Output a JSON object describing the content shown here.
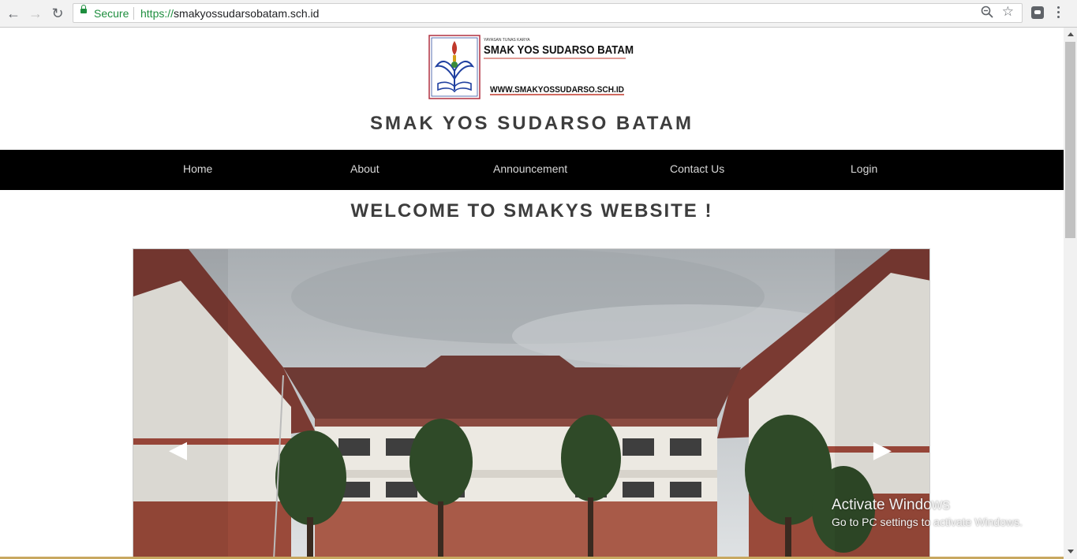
{
  "browser": {
    "secure_label": "Secure",
    "url_scheme": "https://",
    "url_host": "smakyossudarsobatam.sch.id"
  },
  "logo": {
    "org_text": "YAYASAN TUNAS KARYA",
    "school_text": "SMAK YOS SUDARSO BATAM",
    "web_text": "WWW.SMAKYOSSUDARSO.SCH.ID"
  },
  "header": {
    "title": "SMAK YOS SUDARSO BATAM"
  },
  "nav": {
    "items": [
      {
        "label": "Home"
      },
      {
        "label": "About"
      },
      {
        "label": "Announcement"
      },
      {
        "label": "Contact Us"
      },
      {
        "label": "Login"
      }
    ]
  },
  "main": {
    "welcome": "WELCOME TO SMAKYS WEBSITE !"
  },
  "slider": {
    "prev_symbol": "◀",
    "next_symbol": "▶"
  },
  "watermark": {
    "title": "Activate Windows",
    "subtitle": "Go to PC settings to activate Windows."
  },
  "colors": {
    "nav_bg": "#000000",
    "heading": "#3d3d3d",
    "secure_green": "#1e8e3e"
  }
}
